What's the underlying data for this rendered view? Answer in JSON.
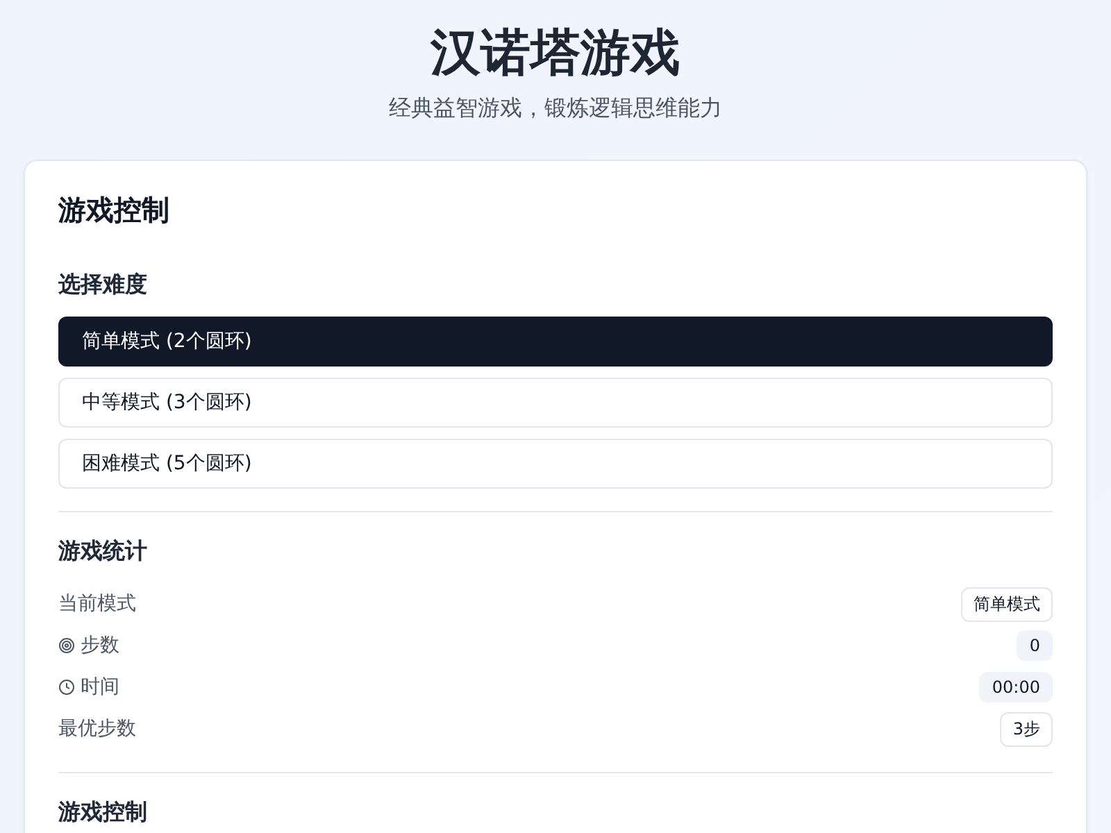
{
  "header": {
    "title": "汉诺塔游戏",
    "subtitle": "经典益智游戏，锻炼逻辑思维能力"
  },
  "panel": {
    "title": "游戏控制",
    "difficulty": {
      "heading": "选择难度",
      "options": [
        {
          "label": "简单模式 (2个圆环)",
          "selected": true
        },
        {
          "label": "中等模式 (3个圆环)",
          "selected": false
        },
        {
          "label": "困难模式 (5个圆环)",
          "selected": false
        }
      ]
    },
    "stats": {
      "heading": "游戏统计",
      "rows": [
        {
          "label": "当前模式",
          "value": "简单模式",
          "kind": "outline"
        },
        {
          "label": "步数",
          "value": "0",
          "kind": "filled"
        },
        {
          "label": "时间",
          "value": "00:00",
          "kind": "filled"
        },
        {
          "label": "最优步数",
          "value": "3步",
          "kind": "outline"
        }
      ]
    },
    "controls": {
      "heading": "游戏控制"
    }
  }
}
